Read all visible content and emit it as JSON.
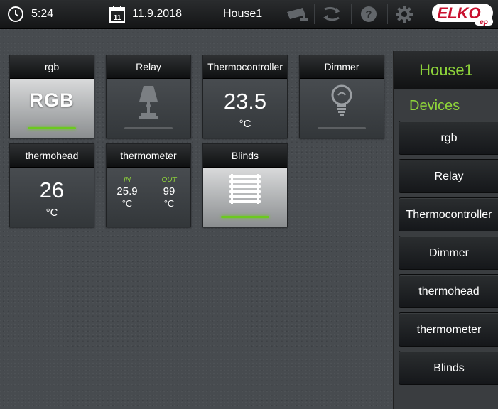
{
  "topbar": {
    "time": "5:24",
    "date": "11.9.2018",
    "date_icon_day": "11",
    "house": "House1",
    "icons": [
      "clock-icon",
      "calendar-icon",
      "camera-icon",
      "scenes-icon",
      "help-icon",
      "settings-icon"
    ],
    "logo_text": "ELKO",
    "logo_sub": "ep"
  },
  "tiles": [
    {
      "title": "rgb",
      "kind": "rgb",
      "label": "RGB",
      "active": true
    },
    {
      "title": "Relay",
      "kind": "lamp",
      "icon": "table-lamp-icon",
      "active": false
    },
    {
      "title": "Thermocontroller",
      "kind": "temp",
      "value": "23.5",
      "unit": "°C"
    },
    {
      "title": "Dimmer",
      "kind": "bulb",
      "icon": "bulb-icon",
      "active": false
    },
    {
      "title": "thermohead",
      "kind": "temp",
      "value": "26",
      "unit": "°C"
    },
    {
      "title": "thermometer",
      "kind": "inout",
      "in_label": "IN",
      "in_value": "25.9",
      "in_unit": "°C",
      "out_label": "OUT",
      "out_value": "99",
      "out_unit": "°C"
    },
    {
      "title": "Blinds",
      "kind": "blinds",
      "icon": "blinds-icon",
      "active": true
    }
  ],
  "panel": {
    "title": "House1",
    "section": "Devices",
    "items": [
      "rgb",
      "Relay",
      "Thermocontroller",
      "Dimmer",
      "thermohead",
      "thermometer",
      "Blinds"
    ]
  },
  "colors": {
    "accent": "#8ed43a",
    "bar_on": "#6cc91f",
    "bar_off": "#5c5f62",
    "background": "#474b4f"
  }
}
